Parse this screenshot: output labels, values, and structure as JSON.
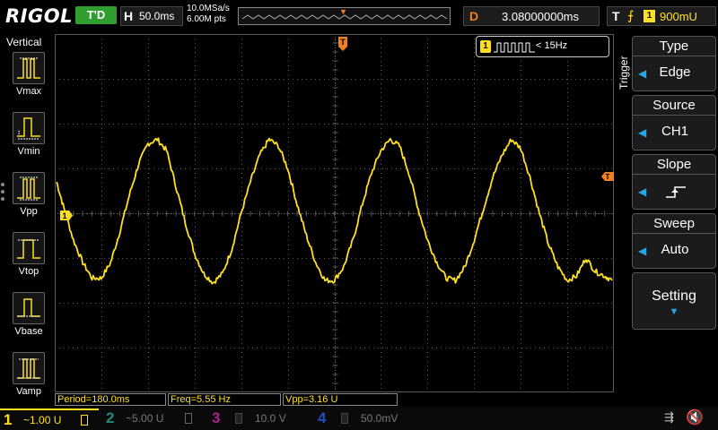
{
  "topbar": {
    "brand": "RIGOL",
    "run_status": "T'D",
    "horizontal": {
      "letter": "H",
      "timebase": "50.0ms"
    },
    "sampling": {
      "rate": "10.0MSa/s",
      "depth": "6.00M pts"
    },
    "delay": {
      "letter": "D",
      "value": "3.08000000ms"
    },
    "trigger": {
      "letter": "T",
      "source": "1",
      "level": "900mU"
    }
  },
  "left_panel": {
    "title": "Vertical",
    "items": [
      {
        "label": "Vmax",
        "icon": "vmax-icon"
      },
      {
        "label": "Vmin",
        "icon": "vmin-icon"
      },
      {
        "label": "Vpp",
        "icon": "vpp-icon"
      },
      {
        "label": "Vtop",
        "icon": "vtop-icon"
      },
      {
        "label": "Vbase",
        "icon": "vbase-icon"
      },
      {
        "label": "Vamp",
        "icon": "vamp-icon"
      }
    ]
  },
  "plot": {
    "trigger_marker": "T",
    "channel_marker": "1",
    "freq_counter": {
      "channel": "1",
      "value": "< 15Hz"
    }
  },
  "trigger_menu": {
    "side_label": "Trigger",
    "sections": [
      {
        "head": "Type",
        "value": "Edge"
      },
      {
        "head": "Source",
        "value": "CH1"
      },
      {
        "head": "Slope",
        "value": "rising-edge"
      },
      {
        "head": "Sweep",
        "value": "Auto"
      }
    ],
    "setting": "Setting"
  },
  "measurements": [
    {
      "text": "Period=180.0ms"
    },
    {
      "text": "Freq=5.55 Hz"
    },
    {
      "text": "Vpp=3.16 U"
    }
  ],
  "channels": [
    {
      "num": "1",
      "value": "~1.00 U",
      "color": "#ffe020",
      "active": true
    },
    {
      "num": "2",
      "value": "~5.00 U",
      "color": "#1e8a80",
      "active": false
    },
    {
      "num": "3",
      "value": "10.0 V",
      "color": "#b0208a",
      "active": false
    },
    {
      "num": "4",
      "value": "50.0mV",
      "color": "#2050c0",
      "active": false
    }
  ],
  "colors": {
    "ch1": "#ffe020",
    "trigger": "#f08020",
    "accent": "#25a6e6",
    "grid": "#5a5a5a"
  },
  "chart_data": {
    "type": "line",
    "title": "",
    "xlabel": "",
    "ylabel": "",
    "x_unit": "ms",
    "y_unit": "U",
    "xlim": [
      -300,
      300
    ],
    "ylim": [
      -4,
      4
    ],
    "series": [
      {
        "x": [
          -298,
          -290,
          -280,
          -270,
          -260,
          -250,
          -240,
          -230,
          -220,
          -210,
          -200,
          -190,
          -180,
          -170,
          -160,
          -150,
          -140,
          -130,
          -120,
          -110,
          -100,
          -90,
          -80,
          -70,
          -60,
          -50,
          -40,
          -30,
          -20,
          -10,
          0,
          10,
          20,
          30,
          40,
          50,
          60,
          70,
          80,
          90,
          100,
          110,
          120,
          130,
          140,
          150,
          160,
          170,
          180,
          190,
          200,
          210,
          220,
          230,
          240,
          250,
          260,
          270,
          280,
          290,
          298
        ],
        "y": [
          0.7,
          0.1,
          -0.6,
          -1.1,
          -1.45,
          -1.45,
          -1.1,
          -0.4,
          0.4,
          1.1,
          1.55,
          1.65,
          1.4,
          0.6,
          -0.2,
          -0.9,
          -1.35,
          -1.55,
          -1.35,
          -0.8,
          0.0,
          0.7,
          1.3,
          1.65,
          1.5,
          1.0,
          0.2,
          -0.5,
          -1.1,
          -1.5,
          -1.5,
          -1.2,
          -0.6,
          0.2,
          0.9,
          1.4,
          1.65,
          1.5,
          0.9,
          0.1,
          -0.6,
          -1.1,
          -1.45,
          -1.5,
          -1.2,
          -0.6,
          0.1,
          0.8,
          1.3,
          1.65,
          1.45,
          0.8,
          0.0,
          -0.7,
          -1.2,
          -1.5,
          -1.4,
          -1.0,
          -1.3,
          -1.4,
          -1.5
        ]
      }
    ]
  }
}
